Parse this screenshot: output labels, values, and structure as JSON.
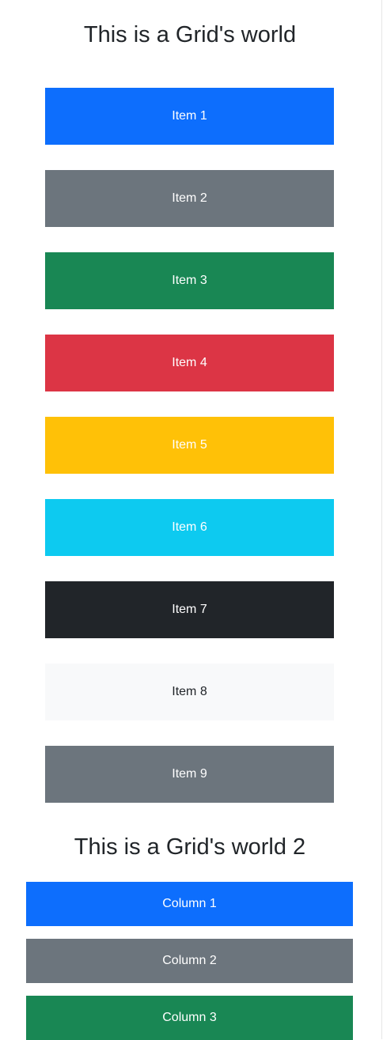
{
  "section1": {
    "title": "This is a Grid's world",
    "items": [
      {
        "label": "Item 1",
        "bg": "#0d6efd",
        "fg": "#ffffff"
      },
      {
        "label": "Item 2",
        "bg": "#6c757d",
        "fg": "#ffffff"
      },
      {
        "label": "Item 3",
        "bg": "#198754",
        "fg": "#ffffff"
      },
      {
        "label": "Item 4",
        "bg": "#dc3545",
        "fg": "#ffffff"
      },
      {
        "label": "Item 5",
        "bg": "#ffc107",
        "fg": "#ffffff"
      },
      {
        "label": "Item 6",
        "bg": "#0dcaf0",
        "fg": "#ffffff"
      },
      {
        "label": "Item 7",
        "bg": "#212529",
        "fg": "#ffffff"
      },
      {
        "label": "Item 8",
        "bg": "#f8f9fa",
        "fg": "#212529"
      },
      {
        "label": "Item 9",
        "bg": "#6c757d",
        "fg": "#ffffff"
      }
    ]
  },
  "section2": {
    "title": "This is a Grid's world 2",
    "columns": [
      {
        "label": "Column 1",
        "bg": "#0d6efd",
        "fg": "#ffffff"
      },
      {
        "label": "Column 2",
        "bg": "#6c757d",
        "fg": "#ffffff"
      },
      {
        "label": "Column 3",
        "bg": "#198754",
        "fg": "#ffffff"
      }
    ]
  }
}
